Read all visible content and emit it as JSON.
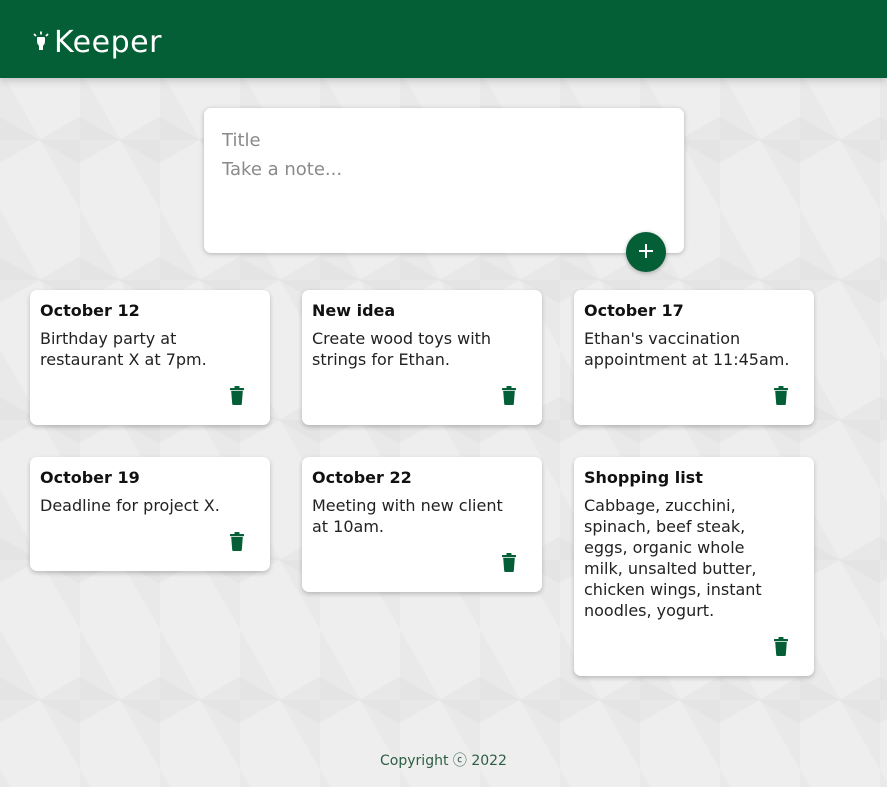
{
  "app": {
    "title": "Keeper",
    "brand_color": "#045f36"
  },
  "composer": {
    "title_placeholder": "Title",
    "content_placeholder": "Take a note...",
    "add_label": "+"
  },
  "notes": [
    {
      "title": "October 12",
      "content": "Birthday party at\nrestaurant X at 7pm."
    },
    {
      "title": "New idea",
      "content": "Create wood toys with\nstrings for Ethan."
    },
    {
      "title": "October 17",
      "content": "Ethan's vaccination\nappointment at 11:45am."
    },
    {
      "title": "October 19",
      "content": "Deadline for project X."
    },
    {
      "title": "October 22",
      "content": "Meeting with new client\nat 10am."
    },
    {
      "title": "Shopping list",
      "content": "Cabbage, zucchini,\nspinach, beef steak,\neggs, organic whole\nmilk, unsalted butter,\nchicken wings, instant\nnoodles, yogurt."
    }
  ],
  "icons": {
    "logo": "lightbulb-icon",
    "add": "plus-icon",
    "delete": "trash-icon"
  },
  "footer": {
    "text": "Copyright ⓒ 2022"
  }
}
